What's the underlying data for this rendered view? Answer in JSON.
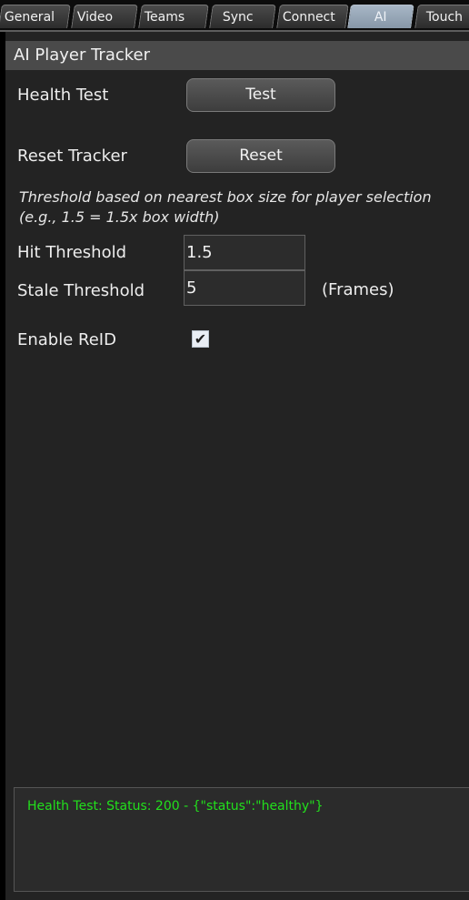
{
  "tabs": [
    {
      "label": "General",
      "active": false
    },
    {
      "label": "Video",
      "active": false
    },
    {
      "label": "Teams",
      "active": false
    },
    {
      "label": "Sync",
      "active": false
    },
    {
      "label": "Connect",
      "active": false
    },
    {
      "label": "AI",
      "active": true
    },
    {
      "label": "Touch",
      "active": false
    }
  ],
  "section": {
    "title": "AI Player Tracker"
  },
  "health_test": {
    "label": "Health Test",
    "button": "Test"
  },
  "reset_tracker": {
    "label": "Reset Tracker",
    "button": "Reset"
  },
  "threshold_hint": "Threshold based on nearest box size for player selection (e.g., 1.5 = 1.5x box width)",
  "hit_threshold": {
    "label": "Hit Threshold",
    "value": "1.5"
  },
  "stale_threshold": {
    "label": "Stale Threshold",
    "value": "5",
    "unit": "(Frames)"
  },
  "enable_reid": {
    "label": "Enable ReID",
    "checked": true,
    "check_glyph": "✔"
  },
  "log": {
    "text": "Health Test: Status: 200 - {\"status\":\"healthy\"}",
    "color": "#22e01c"
  },
  "colors": {
    "active_tab": "#97a7b8",
    "panel": "#232323",
    "header": "#4a4a4a"
  }
}
